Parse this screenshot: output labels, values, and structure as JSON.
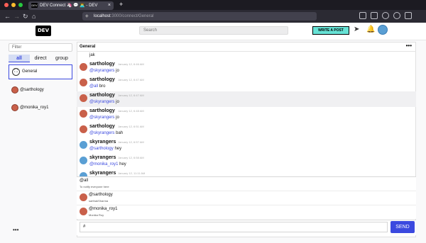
{
  "browser": {
    "tab_title": "DEV Connect 🦄 💬 👨‍💻 - DEV",
    "favicon_text": "DEV",
    "url_host": "localhost",
    "url_path": ":3000/connect/General",
    "newtab_glyph": "+",
    "close_glyph": "×",
    "nav_icons": [
      "back-icon",
      "forward-icon",
      "reload-icon",
      "home-icon"
    ],
    "colors": {
      "close": "#ff5f57",
      "min": "#febc2e",
      "max": "#28c840"
    }
  },
  "header": {
    "logo": "DEV",
    "search_placeholder": "Search",
    "write_post": "WRITE A POST"
  },
  "sidebar": {
    "filter_placeholder": "Filter",
    "tabs": [
      "all",
      "direct",
      "group"
    ],
    "active_tab": "all",
    "channel": "General",
    "dms": [
      "@sarthology",
      "@monika_roy1"
    ],
    "more": "•••"
  },
  "chat": {
    "title": "General",
    "more": "•••",
    "top_partial": "jak",
    "messages": [
      {
        "name": "sarthology",
        "time": "January 12, 6:46 AM",
        "mention": "@skyrangers",
        "text": " jo",
        "avatar": "sarthology"
      },
      {
        "name": "sarthology",
        "time": "January 12, 6:47 AM",
        "mention": "@all",
        "text": " bro",
        "avatar": "sarthology"
      },
      {
        "name": "sarthology",
        "time": "January 12, 6:47 AM",
        "mention": "@skyrangers",
        "text": " jo",
        "avatar": "sarthology",
        "highlight": true
      },
      {
        "name": "sarthology",
        "time": "January 12, 6:48 AM",
        "mention": "@skyrangers",
        "text": " jo",
        "avatar": "sarthology"
      },
      {
        "name": "sarthology",
        "time": "January 12, 6:51 AM",
        "mention": "@skyrangers",
        "text": " bah",
        "avatar": "sarthology"
      },
      {
        "name": "skyrangers",
        "time": "January 12, 6:57 AM",
        "mention": "@sarthology",
        "text": " hey",
        "avatar": "skyrangers"
      },
      {
        "name": "skyrangers",
        "time": "January 12, 6:58 AM",
        "mention": "@monika_roy1",
        "text": " hey",
        "avatar": "skyrangers"
      },
      {
        "name": "skyrangers",
        "time": "January 12, 11:11 AM",
        "mention": "",
        "text": "",
        "avatar": "skyrangers"
      }
    ],
    "suggestions": [
      {
        "name": "@all",
        "sub": "To notify everyone here",
        "avatar": false
      },
      {
        "name": "@sarthology",
        "sub": "sarthakSharma",
        "avatar": true
      },
      {
        "name": "@monika_roy1",
        "sub": "Monika Roy",
        "avatar": true
      }
    ],
    "input_value": "#",
    "send": "SEND"
  }
}
